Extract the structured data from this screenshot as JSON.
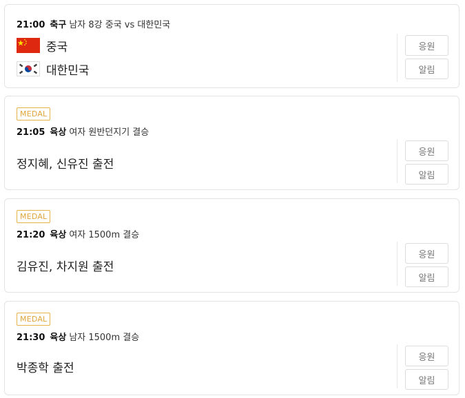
{
  "matches": [
    {
      "time": "21:00",
      "sport": "축구",
      "title": "남자 8강 중국 vs 대한민국",
      "teams": [
        {
          "name": "중국",
          "flag": "china-flag-icon"
        },
        {
          "name": "대한민국",
          "flag": "korea-flag-icon"
        }
      ],
      "cheer_label": "응원",
      "alarm_label": "알림"
    },
    {
      "badge": "MEDAL",
      "time": "21:05",
      "sport": "육상",
      "title": "여자 원반던지기 결승",
      "players": "정지혜, 신유진 출전",
      "cheer_label": "응원",
      "alarm_label": "알림"
    },
    {
      "badge": "MEDAL",
      "time": "21:20",
      "sport": "육상",
      "title": "여자 1500m 결승",
      "players": "김유진, 차지원 출전",
      "cheer_label": "응원",
      "alarm_label": "알림"
    },
    {
      "badge": "MEDAL",
      "time": "21:30",
      "sport": "육상",
      "title": "남자 1500m 결승",
      "players": "박종학 출전",
      "cheer_label": "응원",
      "alarm_label": "알림"
    }
  ],
  "colors": {
    "medal_badge": "#e0a43a",
    "border": "#e3e3e3",
    "button_text": "#777777"
  }
}
